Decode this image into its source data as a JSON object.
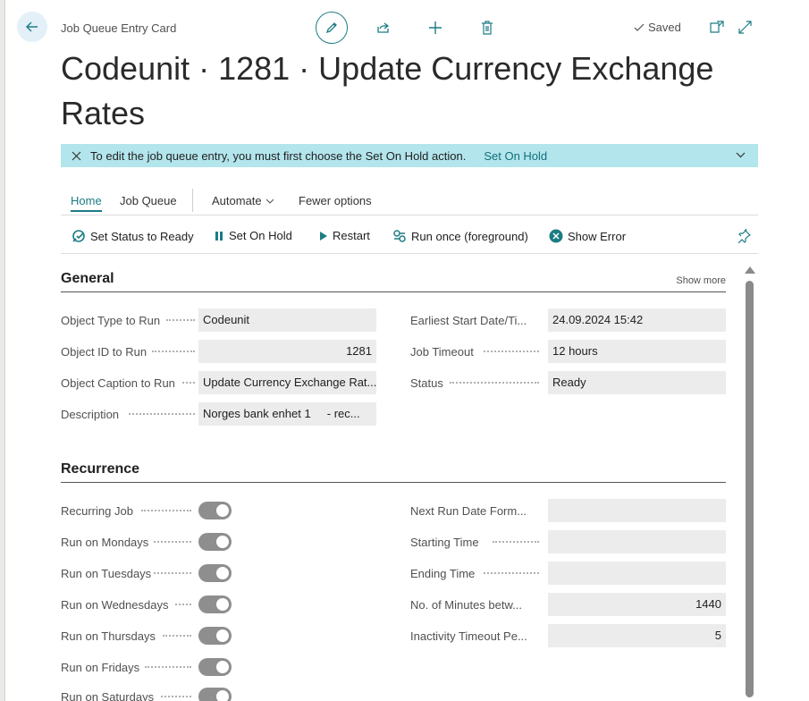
{
  "breadcrumb": "Job Queue Entry Card",
  "saved_label": "Saved",
  "title": "Codeunit · 1281 · Update Currency Exchange Rates",
  "banner": {
    "message": "To edit the job queue entry, you must first choose the Set On Hold action.",
    "action": "Set On Hold"
  },
  "tabs": {
    "home": "Home",
    "job_queue": "Job Queue",
    "automate": "Automate",
    "fewer": "Fewer options"
  },
  "actions": {
    "set_ready": "Set Status to Ready",
    "set_on_hold": "Set On Hold",
    "restart": "Restart",
    "run_once": "Run once (foreground)",
    "show_error": "Show Error"
  },
  "general": {
    "heading": "General",
    "show_more": "Show more",
    "left": [
      {
        "label": "Object Type to Run",
        "value": "Codeunit"
      },
      {
        "label": "Object ID to Run",
        "value": "1281"
      },
      {
        "label": "Object Caption to Run",
        "value": "Update Currency Exchange Rat..."
      },
      {
        "label": "Description",
        "value": "Norges bank enhet 1     - rec..."
      }
    ],
    "right": [
      {
        "label": "Earliest Start Date/Ti...",
        "value": "24.09.2024 15:42"
      },
      {
        "label": "Job Timeout",
        "value": "12 hours"
      },
      {
        "label": "Status",
        "value": "Ready"
      }
    ]
  },
  "recurrence": {
    "heading": "Recurrence",
    "left": [
      {
        "label": "Recurring Job",
        "on": true
      },
      {
        "label": "Run on Mondays",
        "on": true
      },
      {
        "label": "Run on Tuesdays",
        "on": true
      },
      {
        "label": "Run on Wednesdays",
        "on": true
      },
      {
        "label": "Run on Thursdays",
        "on": true
      },
      {
        "label": "Run on Fridays",
        "on": true
      },
      {
        "label": "Run on Saturdays",
        "on": true
      }
    ],
    "right": [
      {
        "label": "Next Run Date Form...",
        "value": ""
      },
      {
        "label": "Starting Time",
        "value": ""
      },
      {
        "label": "Ending Time",
        "value": ""
      },
      {
        "label": "No. of Minutes betw...",
        "value": "1440"
      },
      {
        "label": "Inactivity Timeout Pe...",
        "value": "5"
      }
    ]
  },
  "colors": {
    "accent": "#1c7c84",
    "banner": "#b3e5ec",
    "toggle": "#8e8e8e"
  }
}
